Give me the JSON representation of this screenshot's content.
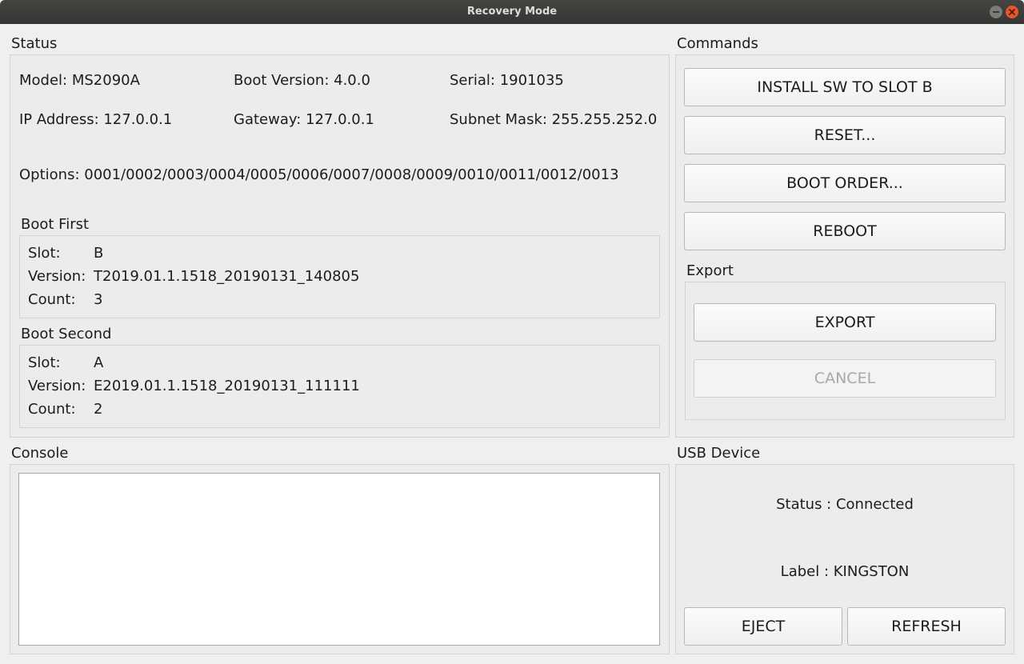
{
  "window": {
    "title": "Recovery Mode"
  },
  "status": {
    "title": "Status",
    "model": "Model: MS2090A",
    "boot_version": "Boot Version: 4.0.0",
    "serial": "Serial: 1901035",
    "ip_address": "IP Address: 127.0.0.1",
    "gateway": "Gateway: 127.0.0.1",
    "subnet_mask": "Subnet Mask: 255.255.252.0",
    "options": "Options: 0001/0002/0003/0004/0005/0006/0007/0008/0009/0010/0011/0012/0013",
    "boot_first": {
      "title": "Boot First",
      "slot_label": "Slot:",
      "slot_value": "B",
      "version_label": "Version:",
      "version_value": "T2019.01.1.1518_20190131_140805",
      "count_label": "Count:",
      "count_value": "3"
    },
    "boot_second": {
      "title": "Boot Second",
      "slot_label": "Slot:",
      "slot_value": "A",
      "version_label": "Version:",
      "version_value": "E2019.01.1.1518_20190131_111111",
      "count_label": "Count:",
      "count_value": "2"
    }
  },
  "commands": {
    "title": "Commands",
    "install": "INSTALL SW TO SLOT B",
    "reset": "RESET...",
    "boot_order": "BOOT ORDER...",
    "reboot": "REBOOT",
    "export": {
      "title": "Export",
      "export_button": "EXPORT",
      "cancel_button": "CANCEL"
    }
  },
  "console": {
    "title": "Console",
    "content": ""
  },
  "usb": {
    "title": "USB Device",
    "status": "Status : Connected",
    "label": "Label : KINGSTON",
    "eject": "EJECT",
    "refresh": "REFRESH"
  }
}
